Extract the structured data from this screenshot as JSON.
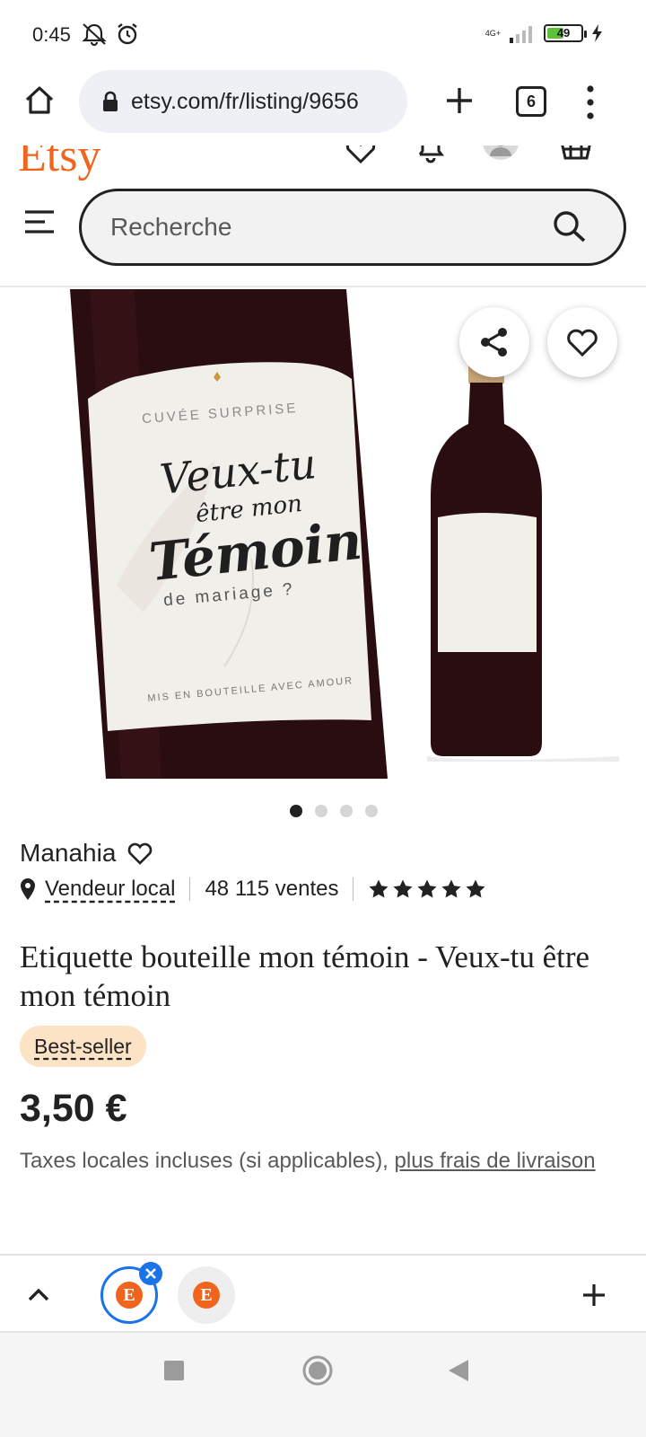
{
  "status_bar": {
    "time": "0:45",
    "network": "4G+",
    "battery": "49"
  },
  "browser": {
    "url": "etsy.com/fr/listing/9656",
    "tab_count": "6"
  },
  "header": {
    "logo": "Etsy",
    "search_placeholder": "Recherche"
  },
  "product_image": {
    "label_top": "CUVÉE SURPRISE",
    "label_line1": "Veux-tu",
    "label_line2": "être mon",
    "label_line3": "Témoin",
    "label_line4": "de mariage ?",
    "label_bottom": "MIS EN BOUTEILLE AVEC AMOUR",
    "slide_count": 4,
    "active_slide": 0
  },
  "listing": {
    "shop_name": "Manahia",
    "local_seller": "Vendeur local",
    "sales": "48 115 ventes",
    "rating": 5,
    "title": "Etiquette bouteille mon témoin - Veux-tu être mon témoin",
    "badge": "Best-seller",
    "price": "3,50 €",
    "tax_note": "Taxes locales incluses (si applicables), ",
    "shipping_link": "plus frais de livraison"
  },
  "colors": {
    "etsy_orange": "#f1641e",
    "active_tab_blue": "#1a73e8",
    "badge_bg": "#fde3c6",
    "wine": "#2a0d10"
  }
}
